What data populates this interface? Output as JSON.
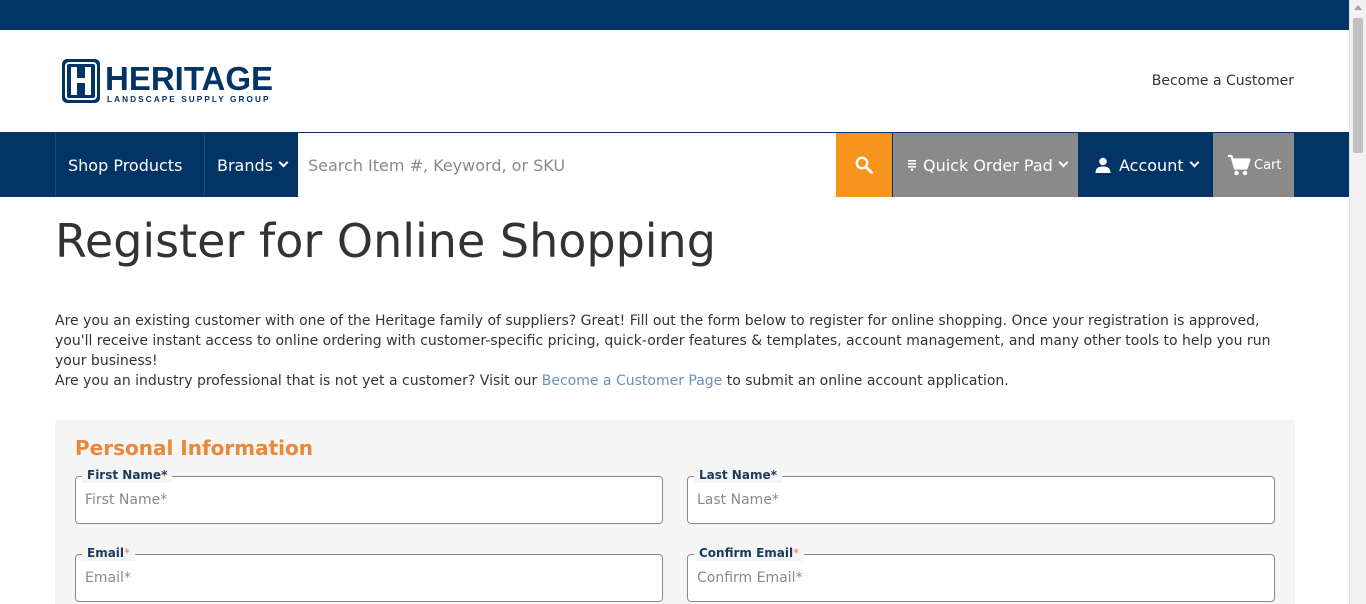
{
  "header": {
    "logo_brand": "HERITAGE",
    "logo_tagline": "LANDSCAPE SUPPLY GROUP",
    "become_customer_link": "Become a Customer"
  },
  "nav": {
    "shop_products": "Shop Products",
    "brands": "Brands",
    "search_placeholder": "Search Item #, Keyword, or SKU",
    "quick_order_pad": "Quick Order Pad",
    "account": "Account",
    "cart": "Cart"
  },
  "page": {
    "title": "Register for Online Shopping",
    "intro_line1": "Are you an existing customer with one of the Heritage family of suppliers? Great! Fill out the form below to register for online shopping. Once your registration is approved, you'll receive instant access to online ordering with customer-specific pricing, quick-order features & templates, account management, and many other tools to help you run your business!",
    "intro_line2_prefix": "Are you an industry professional that is not yet a customer? Visit our ",
    "intro_line2_link": "Become a Customer Page",
    "intro_line2_suffix": " to submit an online account application."
  },
  "form": {
    "section_title": "Personal Information",
    "fields": [
      {
        "label": "First Name",
        "placeholder": "First Name*"
      },
      {
        "label": "Last Name",
        "placeholder": "Last Name*"
      },
      {
        "label": "Email",
        "placeholder": "Email*"
      },
      {
        "label": "Confirm Email",
        "placeholder": "Confirm Email*"
      }
    ],
    "required_mark": "*"
  },
  "colors": {
    "navy": "#033466",
    "orange": "#f7941d",
    "gray": "#8a8a8a",
    "section_title": "#e8883a",
    "link": "#6d8fb3"
  },
  "icons": {
    "search": "search-icon",
    "quick_order": "list-icon",
    "account": "user-icon",
    "cart": "cart-icon",
    "chevron": "chevron-down-icon"
  }
}
